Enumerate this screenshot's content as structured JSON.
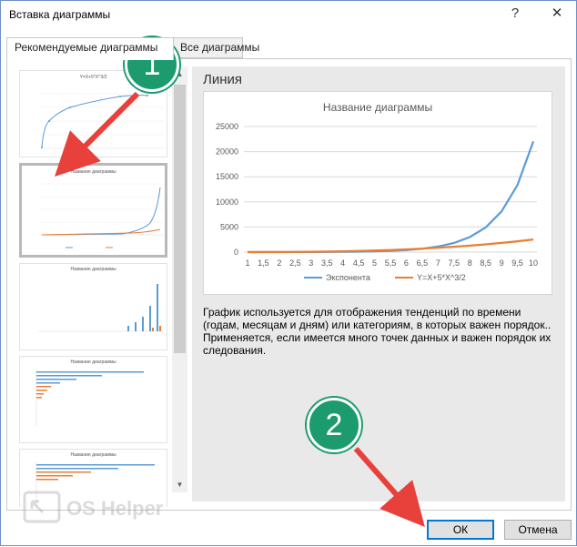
{
  "window": {
    "title": "Вставка диаграммы",
    "help": "?",
    "close": "✕"
  },
  "tabs": [
    {
      "label": "Рекомендуемые диаграммы"
    },
    {
      "label": "Все диаграммы"
    }
  ],
  "thumbs": {
    "t1_title": "Y=X+5*X^3/2",
    "t2_title": "Название диаграммы",
    "t3_title": "Название диаграммы",
    "t4_title": "Название диаграммы",
    "t5_title": "Название диаграммы"
  },
  "preview": {
    "chart_name": "Линия",
    "description": "График используется для отображения тенденций по времени (годам, месяцам и дням) или категориям, в которых важен порядок.. Применяется, если имеется много точек данных и важен порядок их следования."
  },
  "chart_data": {
    "type": "line",
    "title": "Название диаграммы",
    "categories": [
      "1",
      "1,5",
      "2",
      "2,5",
      "3",
      "3,5",
      "4",
      "4,5",
      "5",
      "5,5",
      "6",
      "6,5",
      "7",
      "7,5",
      "8",
      "8,5",
      "9",
      "9,5",
      "10"
    ],
    "series": [
      {
        "name": "Экспонента",
        "color": "#5b9bd5",
        "values": [
          3,
          5,
          7,
          12,
          20,
          33,
          55,
          90,
          148,
          245,
          403,
          665,
          1097,
          1808,
          2981,
          4915,
          8103,
          13360,
          22026
        ]
      },
      {
        "name": "Y=X+5*X^3/2",
        "color": "#ed7d31",
        "values": [
          3.5,
          10,
          22,
          41.6,
          70.5,
          110.7,
          164,
          232.3,
          317.5,
          421.4,
          546,
          693,
          864.5,
          1062,
          1288,
          1543.7,
          1831.5,
          2153,
          2510
        ]
      }
    ],
    "ylim": [
      0,
      25000
    ],
    "yticks": [
      0,
      5000,
      10000,
      15000,
      20000,
      25000
    ],
    "grid": true,
    "legend": "bottom"
  },
  "buttons": {
    "ok": "ОК",
    "cancel": "Отмена"
  },
  "markers": {
    "m1": "1",
    "m2": "2"
  },
  "watermark": {
    "text": "OS Helper"
  },
  "colors": {
    "accent": "#0078d7",
    "marker": "#1c9b6e",
    "arrow": "#e8403a"
  }
}
